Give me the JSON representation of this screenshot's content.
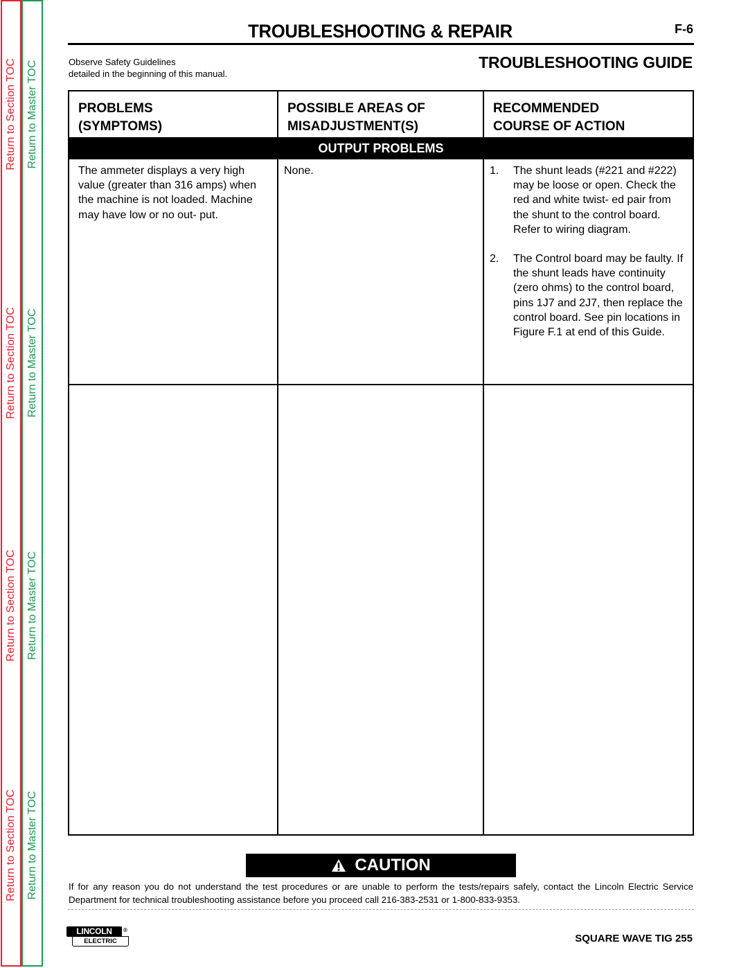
{
  "side_nav": {
    "section_toc_label": "Return to Section TOC",
    "master_toc_label": "Return to Master TOC",
    "section_color": "#e8202f",
    "master_color": "#1a9a55"
  },
  "header": {
    "title": "TROUBLESHOOTING & REPAIR",
    "page_number": "F-6",
    "safety_line1": "Observe Safety Guidelines",
    "safety_line2": "detailed in the beginning of this manual.",
    "guide_title": "TROUBLESHOOTING GUIDE"
  },
  "table": {
    "headers": {
      "col1_line1": "PROBLEMS",
      "col1_line2": "(SYMPTOMS)",
      "col2_line1": "POSSIBLE AREAS OF",
      "col2_line2": "MISADJUSTMENT(S)",
      "col3_line1": "RECOMMENDED",
      "col3_line2": "COURSE OF ACTION"
    },
    "section_band": "OUTPUT PROBLEMS",
    "rows": [
      {
        "symptom": "The ammeter displays a very high value (greater than 316 amps) when the machine is not loaded. Machine may have low or no out- put.",
        "misadjustment": "None.",
        "actions": [
          {
            "num": "1.",
            "text": "The shunt leads (#221 and #222) may be loose or open. Check the red and white twist- ed pair from the shunt to the control board. Refer to wiring diagram."
          },
          {
            "num": "2.",
            "text": "The Control board may be faulty.  If the shunt leads have continuity (zero ohms) to the control board, pins 1J7 and 2J7, then replace the control board. See pin locations in Figure F.1 at end of this Guide."
          }
        ]
      },
      {
        "symptom": "",
        "misadjustment": "",
        "actions": []
      }
    ]
  },
  "caution": {
    "label": "CAUTION",
    "text": "If for any reason you do not understand the test procedures or are unable to perform the tests/repairs safely, contact the Lincoln Electric Service Department for technical troubleshooting assistance before you proceed call 216-383-2531 or 1-800-833-9353."
  },
  "footer": {
    "logo_top": "LINCOLN",
    "logo_bottom": "ELECTRIC",
    "logo_mark": "®",
    "product": "SQUARE WAVE TIG 255"
  }
}
